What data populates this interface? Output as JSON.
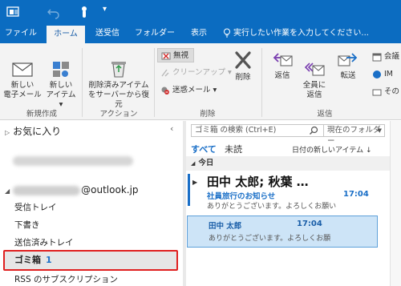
{
  "ribbon_tabs": [
    {
      "label": "ファイル",
      "active": false
    },
    {
      "label": "ホーム",
      "active": true
    },
    {
      "label": "送受信",
      "active": false
    },
    {
      "label": "フォルダー",
      "active": false
    },
    {
      "label": "表示",
      "active": false
    }
  ],
  "tell_me": "実行したい作業を入力してください...",
  "ribbon": {
    "new_email": "新しい\n電子メール",
    "new_items": "新しい\nアイテム ▾",
    "empty_folder": "削除済みアイテム\nをサーバーから復元",
    "ignore": "無視",
    "cleanup": "クリーンアップ ▾",
    "junk": "迷惑メール ▾",
    "delete": "削除",
    "reply": "返信",
    "reply_all": "全員に\n返信",
    "forward": "転送",
    "meeting": "会議",
    "im": "IM",
    "more": "その",
    "groups": {
      "new": "新規作成",
      "action": "アクション",
      "delete": "削除",
      "respond": "返信"
    }
  },
  "folders": {
    "favorites": "お気に入り",
    "account_suffix": "@outlook.jp",
    "items": [
      "受信トレイ",
      "下書き",
      "送信済みトレイ"
    ],
    "trash_label": "ゴミ箱",
    "trash_count": "1",
    "rss": "RSS のサブスクリプション"
  },
  "message_list": {
    "search_placeholder": "ゴミ箱 の検索 (Ctrl+E)",
    "search_scope": "現在のフォルダー",
    "filter_all": "すべて",
    "filter_unread": "未読",
    "sort_label": "日付の新しいアイテム ↓",
    "group_today": "今日",
    "messages": [
      {
        "from": "田中 太郎; 秋葉 …",
        "subject": "社員旅行のお知らせ",
        "time": "17:04",
        "preview": "ありがとうございます。よろしくお願い"
      },
      {
        "from": "田中 太郎",
        "time": "17:04",
        "preview": "ありがとうございます。よろしくお願"
      }
    ]
  },
  "colors": {
    "titlebar": "#0b6cc1",
    "accent": "#1a6fc7",
    "highlight_border": "#e02020",
    "selected_bg": "#cde4f7"
  }
}
